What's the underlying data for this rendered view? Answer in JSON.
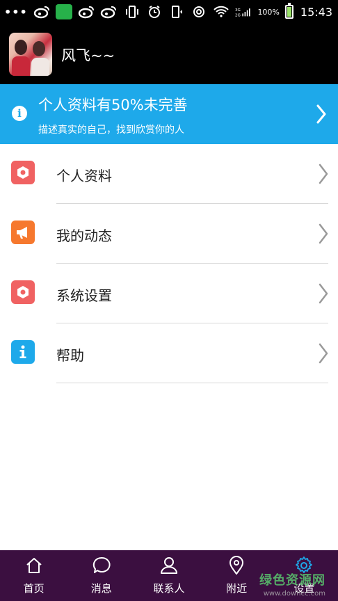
{
  "statusbar": {
    "battery_text": "100%",
    "time": "15:43",
    "battery_level": 1.0
  },
  "profile": {
    "username": "风飞~~"
  },
  "banner": {
    "title": "个人资料有50%未完善",
    "subtitle": "描述真实的自己，找到欣赏你的人"
  },
  "menu": {
    "items": [
      {
        "label": "个人资料",
        "icon": "settings-icon",
        "color": "#f06262"
      },
      {
        "label": "我的动态",
        "icon": "megaphone-icon",
        "color": "#f6782e"
      },
      {
        "label": "系统设置",
        "icon": "settings-icon",
        "color": "#f06262"
      },
      {
        "label": "帮助",
        "icon": "info-icon",
        "color": "#1ea9ea"
      }
    ]
  },
  "bottomnav": {
    "items": [
      {
        "label": "首页",
        "icon": "home-icon"
      },
      {
        "label": "消息",
        "icon": "chat-icon"
      },
      {
        "label": "联系人",
        "icon": "contacts-icon"
      },
      {
        "label": "附近",
        "icon": "location-icon"
      },
      {
        "label": "设置",
        "icon": "gear-icon",
        "active": true
      }
    ],
    "active_color": "#1ea9ea"
  },
  "watermark": {
    "text_main": "绿色资源网",
    "text_sub": "www.downcc.com"
  }
}
